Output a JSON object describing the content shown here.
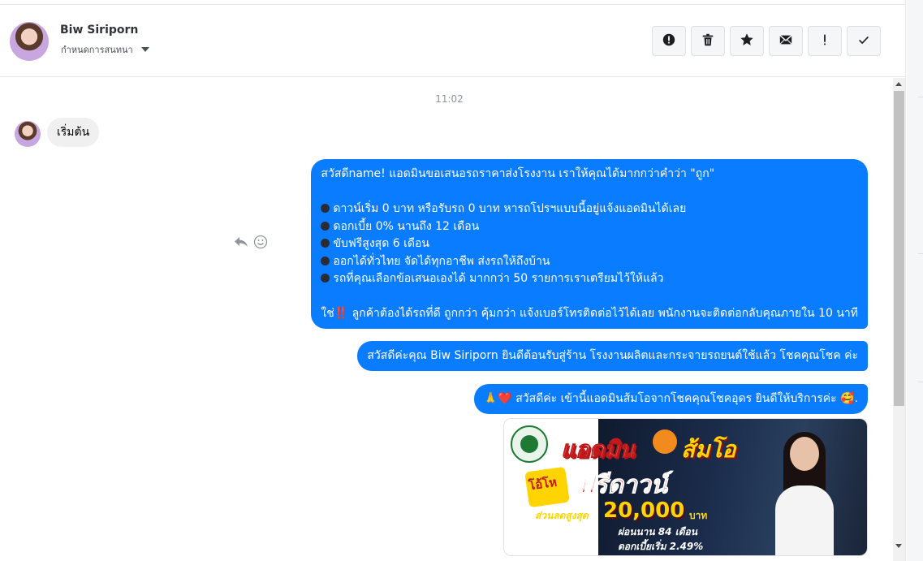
{
  "header": {
    "name": "Biw Siriporn",
    "subtitle": "กำหนดการสนทนา"
  },
  "toolbar": {
    "buttons": [
      {
        "icon": "alert-circle-icon"
      },
      {
        "icon": "trash-icon"
      },
      {
        "icon": "star-icon"
      },
      {
        "icon": "envelope-icon"
      },
      {
        "icon": "exclamation-icon"
      },
      {
        "icon": "checkmark-icon"
      }
    ]
  },
  "conversation": {
    "timestamp": "11:02",
    "incoming": {
      "text": "เริ่มต้น"
    },
    "outgoing": {
      "greeting": "สวัสดีname! แอดมินขอเสนอรถราคาส่งโรงงาน เราให้คุณได้มากกว่าคำว่า \"ถูก\"",
      "bullets": [
        "ดาวน์เริ่ม 0 บาท หรือรับรถ 0 บาท หารถโปรฯแบบนี้อยู่แจ้งแอดมินได้เลย",
        "ดอกเบี้ย 0% นานถึง 12 เดือน",
        "ขับฟรีสูงสุด 6 เดือน",
        "ออกได้ทั่วไทย จัดได้ทุกอาชีพ ส่งรถให้ถึงบ้าน",
        "รถที่คุณเลือกข้อเสนอเองได้ มากกว่า 50 รายการเราเตรียมไว้ให้แล้ว"
      ],
      "closing_prefix": "ใช่",
      "closing_mark": "‼️",
      "closing_text": "ลูกค้าต้องได้รถที่ดี ถูกกว่า คุ้มกว่า แจ้งเบอร์โทรติดต่อไว้ได้เลย พนักงานจะติดต่อกลับคุณภายใน 10 นาที",
      "welcome": "สวัสดีค่ะคุณ Biw Siriporn ยินดีต้อนรับสู่ร้าน โรงงานผลิตและกระจายรถยนต์ใช้แล้ว โชคคุณโชค ค่ะ",
      "intro_emoji": "🙏❤️",
      "intro_text": "สวัสดีค่ะ เข้านี้แอดมินส้มโอจากโชคคุณโชคอุดร ยินดีให้บริการค่ะ",
      "intro_end": "🥰."
    },
    "image_promo": {
      "title": "แอดมิน",
      "name": "ส้มโอ",
      "badge": "โอ้โห",
      "headline": "ฟรีดาวน์",
      "discount_label": "ส่วนลดสูงสุด",
      "discount_amount": "20,000",
      "discount_unit": "บาท",
      "months": "ผ่อนนาน 84 เดือน",
      "rate": "ดอกเบี้ยเริ่ม 2.49%"
    }
  },
  "colors": {
    "outgoing_bubble": "#0a7cff",
    "incoming_bubble": "#f1f0f0"
  }
}
